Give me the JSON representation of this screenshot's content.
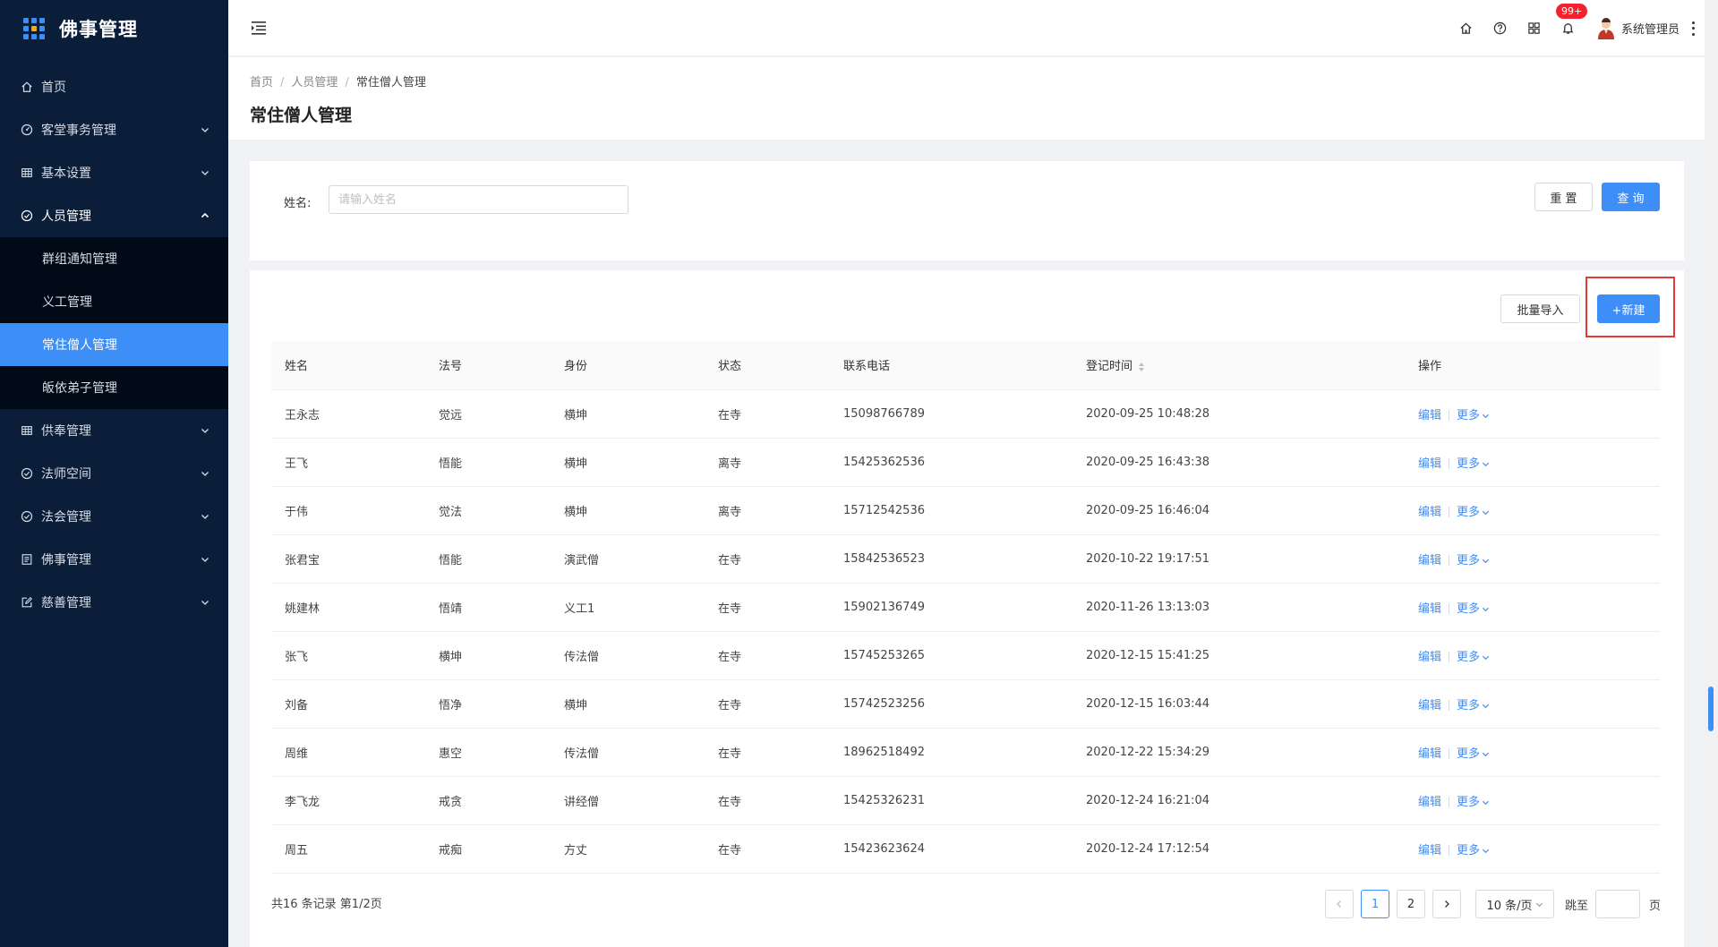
{
  "app": {
    "title": "佛事管理"
  },
  "colors": {
    "primary": "#3e8ef7",
    "sidebar_bg": "#0b1e39",
    "highlight": "#e53935",
    "badge": "#f5222d"
  },
  "sidebar": {
    "items": [
      {
        "label": "首页",
        "icon": "home-icon"
      },
      {
        "label": "客堂事务管理",
        "icon": "dashboard-icon"
      },
      {
        "label": "基本设置",
        "icon": "table-icon"
      },
      {
        "label": "人员管理",
        "icon": "check-circle-icon",
        "open": true,
        "children": [
          {
            "label": "群组通知管理"
          },
          {
            "label": "义工管理"
          },
          {
            "label": "常住僧人管理",
            "active": true
          },
          {
            "label": "皈依弟子管理"
          }
        ]
      },
      {
        "label": "供奉管理",
        "icon": "table-icon"
      },
      {
        "label": "法师空间",
        "icon": "check-circle-icon"
      },
      {
        "label": "法会管理",
        "icon": "check-circle-icon"
      },
      {
        "label": "佛事管理",
        "icon": "list-icon"
      },
      {
        "label": "慈善管理",
        "icon": "edit-icon"
      }
    ]
  },
  "header": {
    "notifications_badge": "99+",
    "username": "系统管理员"
  },
  "breadcrumb": [
    "首页",
    "人员管理",
    "常住僧人管理"
  ],
  "page_title": "常住僧人管理",
  "search": {
    "name_label": "姓名:",
    "name_placeholder": "请输入姓名",
    "name_value": "",
    "reset_label": "重 置",
    "query_label": "查 询"
  },
  "toolbar": {
    "import_label": "批量导入",
    "new_label": "+新建"
  },
  "table": {
    "columns": [
      "姓名",
      "法号",
      "身份",
      "状态",
      "联系电话",
      "登记时间",
      "操作"
    ],
    "edit_label": "编辑",
    "more_label": "更多",
    "rows": [
      {
        "name": "王永志",
        "dharma": "觉远",
        "identity": "横坤",
        "status": "在寺",
        "phone": "15098766789",
        "time": "2020-09-25 10:48:28"
      },
      {
        "name": "王飞",
        "dharma": "悟能",
        "identity": "横坤",
        "status": "离寺",
        "phone": "15425362536",
        "time": "2020-09-25 16:43:38"
      },
      {
        "name": "于伟",
        "dharma": "觉法",
        "identity": "横坤",
        "status": "离寺",
        "phone": "15712542536",
        "time": "2020-09-25 16:46:04"
      },
      {
        "name": "张君宝",
        "dharma": "悟能",
        "identity": "演武僧",
        "status": "在寺",
        "phone": "15842536523",
        "time": "2020-10-22 19:17:51"
      },
      {
        "name": "姚建林",
        "dharma": "悟靖",
        "identity": "义工1",
        "status": "在寺",
        "phone": "15902136749",
        "time": "2020-11-26 13:13:03"
      },
      {
        "name": "张飞",
        "dharma": "横坤",
        "identity": "传法僧",
        "status": "在寺",
        "phone": "15745253265",
        "time": "2020-12-15 15:41:25"
      },
      {
        "name": "刘备",
        "dharma": "悟净",
        "identity": "横坤",
        "status": "在寺",
        "phone": "15742523256",
        "time": "2020-12-15 16:03:44"
      },
      {
        "name": "周维",
        "dharma": "惠空",
        "identity": "传法僧",
        "status": "在寺",
        "phone": "18962518492",
        "time": "2020-12-22 15:34:29"
      },
      {
        "name": "李飞龙",
        "dharma": "戒贪",
        "identity": "讲经僧",
        "status": "在寺",
        "phone": "15425326231",
        "time": "2020-12-24 16:21:04"
      },
      {
        "name": "周五",
        "dharma": "戒痴",
        "identity": "方丈",
        "status": "在寺",
        "phone": "15423623624",
        "time": "2020-12-24 17:12:54"
      }
    ]
  },
  "pagination": {
    "summary": "共16 条记录 第1/2页",
    "pages": [
      "1",
      "2"
    ],
    "current": "1",
    "page_size": "10 条/页",
    "jump_label": "跳至",
    "page_suffix": "页"
  }
}
